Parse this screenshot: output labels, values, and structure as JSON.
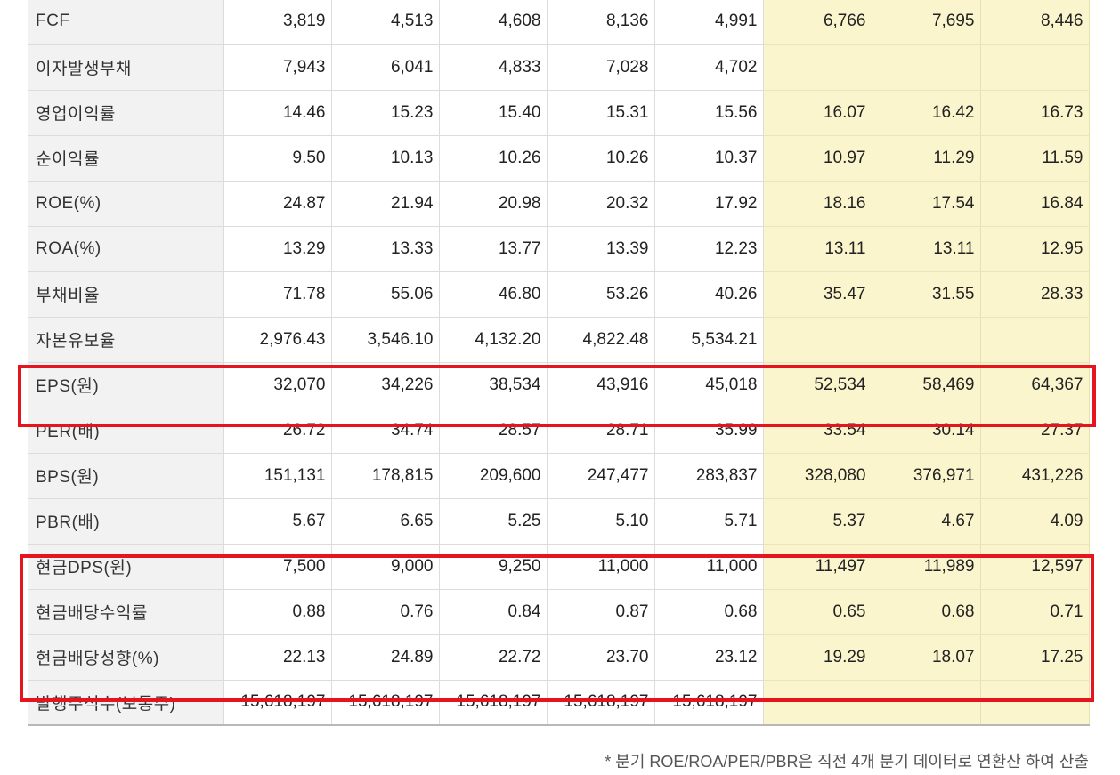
{
  "table": {
    "rows": [
      {
        "label": "FCF",
        "values": [
          "3,819",
          "4,513",
          "4,608",
          "8,136",
          "4,991",
          "6,766",
          "7,695",
          "8,446"
        ]
      },
      {
        "label": "이자발생부채",
        "values": [
          "7,943",
          "6,041",
          "4,833",
          "7,028",
          "4,702",
          "",
          "",
          ""
        ]
      },
      {
        "label": "영업이익률",
        "values": [
          "14.46",
          "15.23",
          "15.40",
          "15.31",
          "15.56",
          "16.07",
          "16.42",
          "16.73"
        ]
      },
      {
        "label": "순이익률",
        "values": [
          "9.50",
          "10.13",
          "10.26",
          "10.26",
          "10.37",
          "10.97",
          "11.29",
          "11.59"
        ]
      },
      {
        "label": "ROE(%)",
        "values": [
          "24.87",
          "21.94",
          "20.98",
          "20.32",
          "17.92",
          "18.16",
          "17.54",
          "16.84"
        ]
      },
      {
        "label": "ROA(%)",
        "values": [
          "13.29",
          "13.33",
          "13.77",
          "13.39",
          "12.23",
          "13.11",
          "13.11",
          "12.95"
        ]
      },
      {
        "label": "부채비율",
        "values": [
          "71.78",
          "55.06",
          "46.80",
          "53.26",
          "40.26",
          "35.47",
          "31.55",
          "28.33"
        ]
      },
      {
        "label": "자본유보율",
        "values": [
          "2,976.43",
          "3,546.10",
          "4,132.20",
          "4,822.48",
          "5,534.21",
          "",
          "",
          ""
        ]
      },
      {
        "label": "EPS(원)",
        "values": [
          "32,070",
          "34,226",
          "38,534",
          "43,916",
          "45,018",
          "52,534",
          "58,469",
          "64,367"
        ]
      },
      {
        "label": "PER(배)",
        "values": [
          "26.72",
          "34.74",
          "28.57",
          "28.71",
          "35.99",
          "33.54",
          "30.14",
          "27.37"
        ]
      },
      {
        "label": "BPS(원)",
        "values": [
          "151,131",
          "178,815",
          "209,600",
          "247,477",
          "283,837",
          "328,080",
          "376,971",
          "431,226"
        ]
      },
      {
        "label": "PBR(배)",
        "values": [
          "5.67",
          "6.65",
          "5.25",
          "5.10",
          "5.71",
          "5.37",
          "4.67",
          "4.09"
        ]
      },
      {
        "label": "현금DPS(원)",
        "values": [
          "7,500",
          "9,000",
          "9,250",
          "11,000",
          "11,000",
          "11,497",
          "11,989",
          "12,597"
        ]
      },
      {
        "label": "현금배당수익률",
        "values": [
          "0.88",
          "0.76",
          "0.84",
          "0.87",
          "0.68",
          "0.65",
          "0.68",
          "0.71"
        ]
      },
      {
        "label": "현금배당성향(%)",
        "values": [
          "22.13",
          "24.89",
          "22.72",
          "23.70",
          "23.12",
          "19.29",
          "18.07",
          "17.25"
        ]
      },
      {
        "label": "발행주식수(보통주)",
        "values": [
          "15,618,197",
          "15,618,197",
          "15,618,197",
          "15,618,197",
          "15,618,197",
          "",
          "",
          ""
        ]
      }
    ]
  },
  "footnote": "* 분기 ROE/ROA/PER/PBR은 직전 4개 분기 데이터로 연환산 하여 산출",
  "footnote_cont": "",
  "colors": {
    "estimate_bg": "#fbf5cd",
    "label_bg": "#f2f2f2",
    "highlight_border": "#e5141f"
  }
}
